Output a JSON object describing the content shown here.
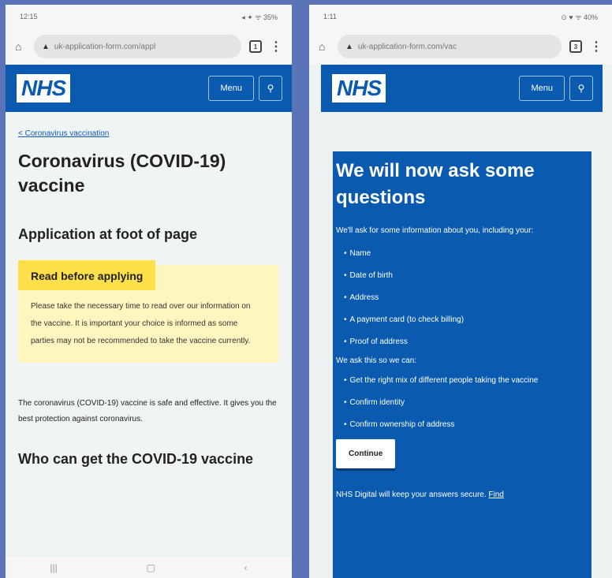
{
  "left_phone": {
    "status": {
      "time": "12:15",
      "icons": "◂ ✦ ᯤ 35%"
    },
    "url": "uk-application-form.com/appl",
    "header": {
      "logo": "NHS",
      "menu_label": "Menu"
    },
    "breadcrumb": "< Coronavirus vaccination",
    "title": "Coronavirus (COVID-19) vaccine",
    "subheading": "Application at foot of page",
    "warning": {
      "label": "Read before applying",
      "text": "Please take the necessary time to read over our information on the vaccine. It is important your choice is informed as some parties may not be recommended to take the vaccine currently."
    },
    "body_text": "The coronavirus (COVID-19) vaccine is safe and effective. It gives you the best protection against coronavirus.",
    "section_heading": "Who can get the COVID-19 vaccine"
  },
  "right_phone": {
    "status": {
      "time": "1:11",
      "icons": "⊙ ♥ ᯤ 40%"
    },
    "url": "uk-application-form.com/vac",
    "header": {
      "logo": "NHS",
      "menu_label": "Menu"
    },
    "panel": {
      "title": "We will now ask some questions",
      "intro": "We'll ask for some information about you, including your:",
      "fields": [
        "Name",
        "Date of birth",
        "Address",
        "A payment card (to check billing)",
        "Proof of address"
      ],
      "reasons_intro": "We ask this so we can:",
      "reasons": [
        "Get the right mix of different people taking the vaccine",
        "Confirm identity",
        "Confirm ownership of address"
      ],
      "continue_label": "Continue",
      "footer": "NHS Digital will keep your answers secure.",
      "footer_link": "Find"
    }
  },
  "colors": {
    "nhs_blue": "#0a5bb0",
    "warning_yellow": "#ffe04a",
    "warning_bg": "#fff5bf"
  }
}
